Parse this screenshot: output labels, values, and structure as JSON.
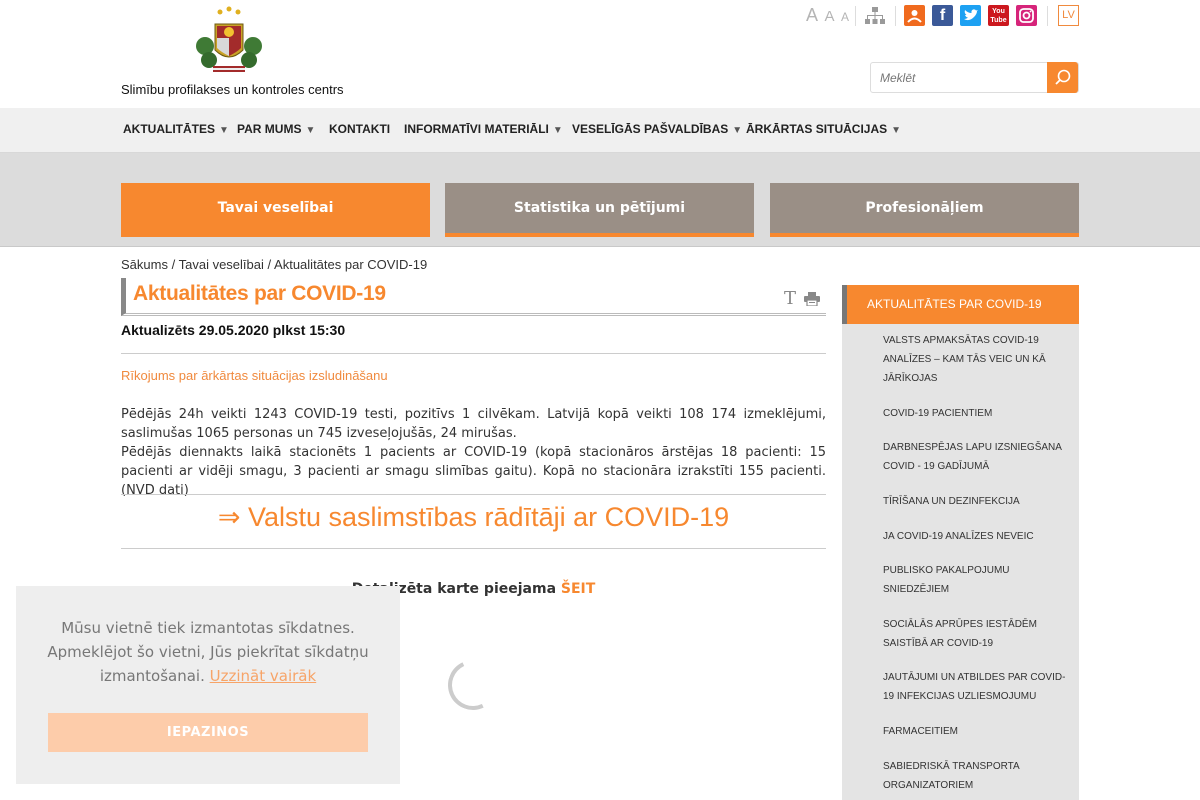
{
  "header": {
    "org_name": "Slimību profilakses un kontroles centrs",
    "font_sizes": [
      "A",
      "A",
      "A"
    ],
    "language": "LV",
    "search_placeholder": "Meklēt",
    "social": [
      {
        "name": "rss",
        "glyph": "",
        "color": "#f06a1e"
      },
      {
        "name": "facebook",
        "glyph": "f",
        "color": "#3b5998"
      },
      {
        "name": "twitter",
        "glyph": "",
        "color": "#1da1f2"
      },
      {
        "name": "youtube",
        "glyph": "You Tube",
        "color": "#cc181e"
      },
      {
        "name": "instagram",
        "glyph": "",
        "color": "#d6247a"
      }
    ]
  },
  "nav": {
    "items": [
      {
        "label": "AKTUALITĀTES",
        "has_submenu": true
      },
      {
        "label": "PAR MUMS",
        "has_submenu": true
      },
      {
        "label": "KONTAKTI",
        "has_submenu": false
      },
      {
        "label": "INFORMATĪVI MATERIĀLI",
        "has_submenu": true
      },
      {
        "label": "VESELĪGĀS PAŠVALDĪBAS",
        "has_submenu": true
      },
      {
        "label": "ĀRKĀRTAS SITUĀCIJAS",
        "has_submenu": true
      }
    ],
    "arrow": "▼"
  },
  "band_tabs": [
    {
      "label": "Tavai veselībai",
      "active": true
    },
    {
      "label": "Statistika un pētījumi",
      "active": false
    },
    {
      "label": "Profesionāļiem",
      "active": false
    }
  ],
  "breadcrumb": {
    "home": "Sākums",
    "section": "Tavai veselībai",
    "current": "Aktualitātes par COVID-19",
    "separator": "/"
  },
  "article": {
    "title": "Aktualitātes par COVID-19",
    "text_size_tool": "T",
    "updated": "Aktualizēts 29.05.2020 plkst 15:30",
    "order_link": "Rīkojums par ārkārtas situācijas izsludināšanu",
    "para1": "Pēdējās 24h veikti 1243 COVID-19 testi, pozitīvs 1 cilvēkam. Latvijā kopā veikti 108 174 izmeklējumi, saslimušas 1065 personas un 745 izveseļojušās, 24 mirušas.",
    "para2": "Pēdējās diennakts laikā stacionēts 1 pacients ar COVID-19 (kopā stacionāros ārstējas 18 pacienti: 15 pacienti ar vidēji smagu, 3 pacienti ar smagu slimības gaitu). Kopā no stacionāra izrakstīti 155 pacienti. (NVD dati)",
    "big_link": "⇒ Valstu saslimstības rādītāji ar COVID-19",
    "map_text": "Detalizēta karte pieejama",
    "map_link": "ŠEIT"
  },
  "sidebar": {
    "heading": "AKTUALITĀTES PAR COVID-19",
    "items": [
      "VALSTS APMAKSĀTAS COVID-19 ANALĪZES – KAM TĀS VEIC UN KĀ JĀRĪKOJAS",
      "COVID-19 PACIENTIEM",
      "DARBNESPĒJAS LAPU IZSNIEGŠANA COVID - 19 GADĪJUMĀ",
      "TĪRĪŠANA UN DEZINFEKCIJA",
      "JA COVID-19 ANALĪZES NEVEIC",
      "PUBLISKO PAKALPOJUMU SNIEDZĒJIEM",
      "SOCIĀLĀS APRŪPES IESTĀDĒM SAISTĪBĀ AR COVID-19",
      "JAUTĀJUMI UN ATBILDES PAR COVID-19 INFEKCIJAS UZLIESMOJUMU",
      "FARMACEITIEM",
      "SABIEDRISKĀ TRANSPORTA ORGANIZATORIEM"
    ]
  },
  "cookie": {
    "text": "Mūsu vietnē tiek izmantotas sīkdatnes. Apmeklējot šo vietni, Jūs piekrītat sīkdatņu izmantošanai.",
    "learn_more": "Uzzināt vairāk",
    "button": "IEPAZINOS"
  },
  "colors": {
    "accent": "#f7882f",
    "tab_inactive": "#9a8f86",
    "nav_bg": "#f0f0f0",
    "band_bg": "#dcdcdc",
    "sidebar_bg": "#e4e4e4"
  }
}
